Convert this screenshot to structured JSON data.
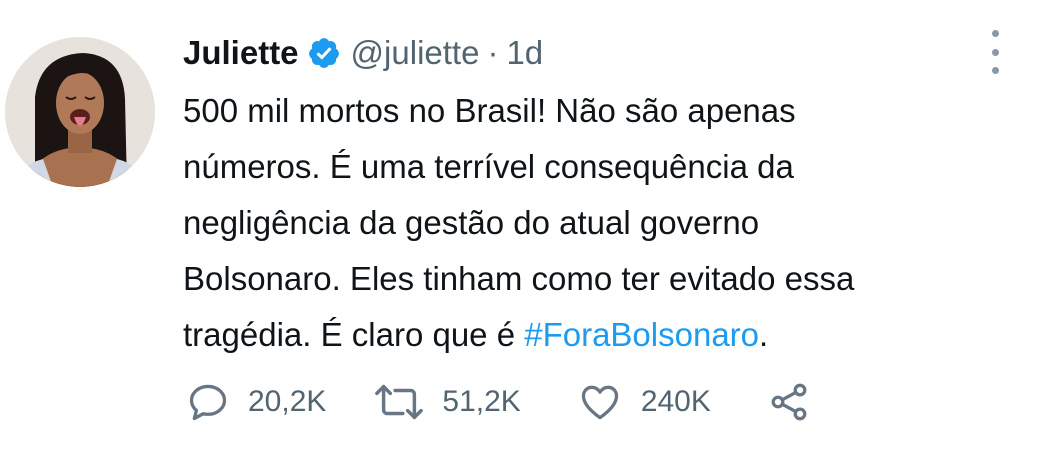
{
  "tweet": {
    "author": {
      "name": "Juliette",
      "handle": "@juliette",
      "separator": "·",
      "time": "1d",
      "verified_icon": "verified-badge-icon",
      "avatar_icon": "profile-photo"
    },
    "text_before": "500 mil mortos no Brasil! Não são apenas\nnúmeros. É uma terrível consequência da\nnegligência da gestão do atual governo\nBolsonaro. Eles tinham como ter evitado essa\ntragédia. É claro que é ",
    "hashtag": "#ForaBolsonaro",
    "text_after": ".",
    "menu_icon": "more-options-icon",
    "actions": {
      "reply": {
        "icon": "reply-icon",
        "count": "20,2K"
      },
      "retweet": {
        "icon": "retweet-icon",
        "count": "51,2K"
      },
      "like": {
        "icon": "like-icon",
        "count": "240K"
      },
      "share": {
        "icon": "share-icon"
      }
    },
    "colors": {
      "accent": "#1d9bf0",
      "text": "#0f1419",
      "secondary": "#536471",
      "icon": "#687684"
    }
  }
}
